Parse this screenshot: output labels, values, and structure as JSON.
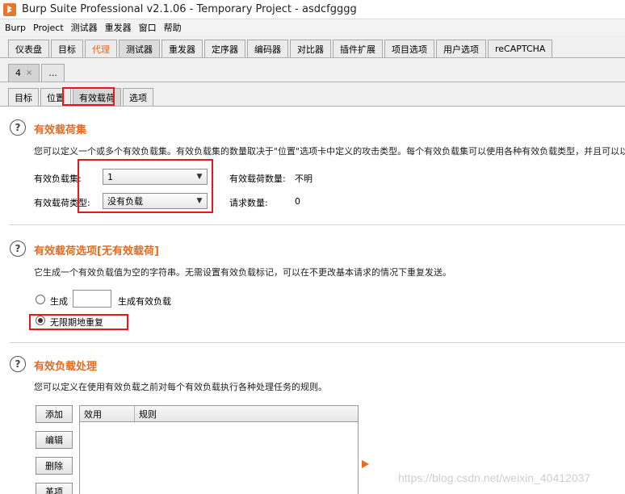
{
  "window": {
    "title": "Burp Suite Professional v2.1.06 - Temporary Project - asdcfgggg"
  },
  "menu": [
    "Burp",
    "Project",
    "测试器",
    "重发器",
    "窗口",
    "帮助"
  ],
  "main_tabs": [
    {
      "label": "仪表盘"
    },
    {
      "label": "目标"
    },
    {
      "label": "代理"
    },
    {
      "label": "测试器"
    },
    {
      "label": "重发器"
    },
    {
      "label": "定序器"
    },
    {
      "label": "编码器"
    },
    {
      "label": "对比器"
    },
    {
      "label": "插件扩展"
    },
    {
      "label": "项目选项"
    },
    {
      "label": "用户选项"
    },
    {
      "label": "reCAPTCHA"
    }
  ],
  "sub_tabs": {
    "attack_tab": "4",
    "close_symbol": "×",
    "more": "..."
  },
  "intruder_tabs": [
    "目标",
    "位置",
    "有效载荷",
    "选项"
  ],
  "payload_sets": {
    "title": "有效载荷集",
    "description": "您可以定义一个或多个有效负载集。有效负载集的数量取决于\"位置\"选项卡中定义的攻击类型。每个有效负载集可以使用各种有效负载类型，并且可以以",
    "set_label": "有效负载集:",
    "set_value": "1",
    "type_label": "有效载荷类型:",
    "type_value": "没有负载",
    "count_label": "有效载荷数量:",
    "count_value": "不明",
    "request_label": "请求数量:",
    "request_value": "0"
  },
  "payload_options": {
    "title": "有效载荷选项[无有效载荷]",
    "description": "它生成一个有效负载值为空的字符串。无需设置有效负载标记，可以在不更改基本请求的情况下重复发送。",
    "generate_label": "生成",
    "generate_suffix": "生成有效负载",
    "infinite_label": "无限期地重复"
  },
  "payload_processing": {
    "title": "有效负载处理",
    "description": "您可以定义在使用有效负载之前对每个有效负载执行各种处理任务的规则。",
    "buttons": {
      "add": "添加",
      "edit": "编辑",
      "remove": "删除",
      "up": "革项"
    },
    "columns": {
      "enabled": "效用",
      "rule": "规则"
    }
  },
  "watermark": "https://blog.csdn.net/weixin_40412037",
  "colors": {
    "accent": "#e36b22",
    "highlight_box": "#e8151b"
  },
  "icons": {
    "help": "help-icon",
    "app": "burp-logo-icon",
    "dropdown": "dropdown-arrow-icon"
  }
}
